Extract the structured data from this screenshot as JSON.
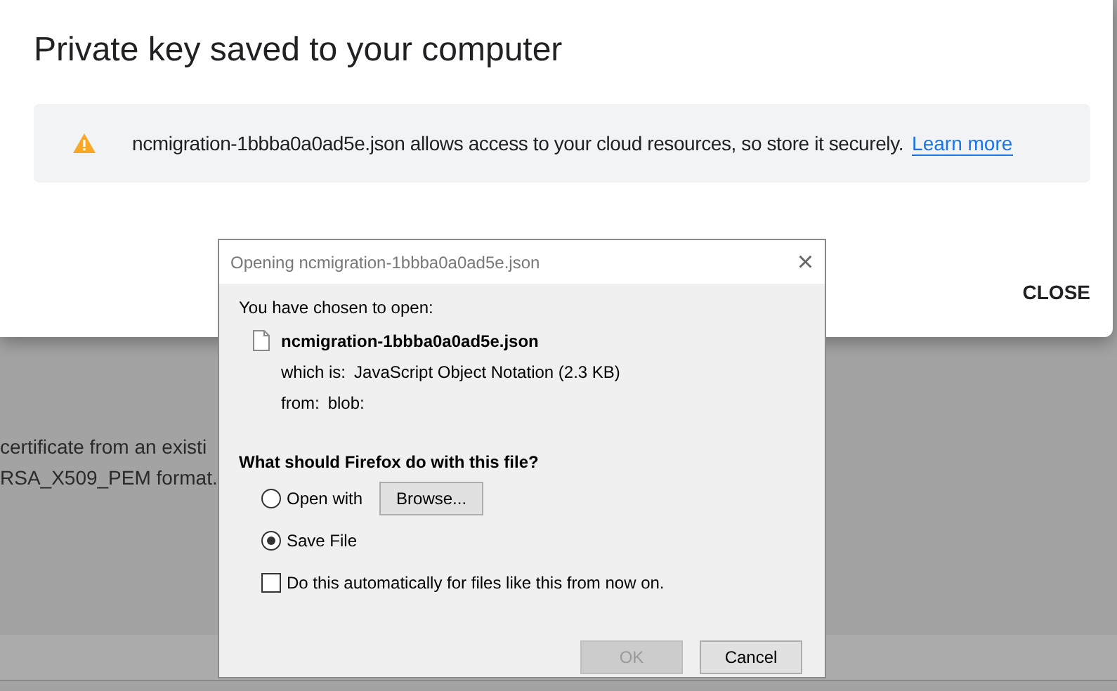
{
  "background_page": {
    "lines": [
      "certificate from an existi",
      "RSA_X509_PEM format."
    ]
  },
  "modal": {
    "title": "Private key saved to your computer",
    "notice": {
      "text": "ncmigration-1bbba0a0ad5e.json allows access to your cloud resources, so store it securely.",
      "link": "Learn more"
    },
    "close_button": "CLOSE"
  },
  "download_dialog": {
    "title": "Opening ncmigration-1bbba0a0ad5e.json",
    "close_glyph": "×",
    "intro": "You have chosen to open:",
    "file_name": "ncmigration-1bbba0a0ad5e.json",
    "details": [
      {
        "label": "which is:",
        "value": "JavaScript Object Notation (2.3 KB)"
      },
      {
        "label": "from:",
        "value": "blob:"
      }
    ],
    "question": "What should Firefox do with this file?",
    "options": [
      {
        "label": "Open with",
        "selected": false,
        "button": "Browse..."
      },
      {
        "label": "Save File",
        "selected": true
      }
    ],
    "remember": {
      "label": "Do this automatically for files like this from now on.",
      "checked": false
    },
    "buttons": [
      {
        "label": "OK",
        "disabled": true
      },
      {
        "label": "Cancel",
        "disabled": false
      }
    ]
  }
}
